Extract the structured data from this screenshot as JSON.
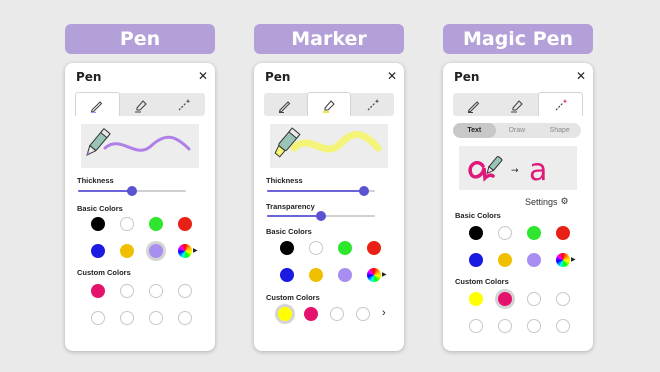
{
  "banners": [
    "Pen",
    "Marker",
    "Magic Pen"
  ],
  "panel_title": "Pen",
  "close_glyph": "✕",
  "section_basic": "Basic Colors",
  "section_custom": "Custom Colors",
  "pen": {
    "thickness_label": "Thickness",
    "thickness_value": 0.5,
    "basic_colors": [
      "#000000",
      "#ffffff",
      "#2ee62e",
      "#e82015",
      "#1a1ae0",
      "#f0c000",
      "#a88ef0",
      "wheel"
    ],
    "selected_basic": 6,
    "custom_colors": [
      "#e5126d",
      "empty",
      "empty",
      "empty",
      "empty",
      "empty",
      "empty",
      "empty"
    ]
  },
  "marker": {
    "thickness_label": "Thickness",
    "thickness_value": 0.9,
    "transparency_label": "Transparency",
    "transparency_value": 0.5,
    "basic_colors": [
      "#000000",
      "#ffffff",
      "#2ee62e",
      "#e82015",
      "#1a1ae0",
      "#f0c000",
      "#a88ef0",
      "wheel"
    ],
    "custom_colors": [
      "#ffff00",
      "#e5126d",
      "empty",
      "empty"
    ],
    "selected_custom": 0
  },
  "magic": {
    "modes": [
      "Text",
      "Draw",
      "Shape"
    ],
    "active_mode": 0,
    "demo_result": "a",
    "demo_arrow": "→",
    "settings_label": "Settings",
    "basic_colors": [
      "#000000",
      "#ffffff",
      "#2ee62e",
      "#e82015",
      "#1a1ae0",
      "#f0c000",
      "#a88ef0",
      "wheel"
    ],
    "custom_colors": [
      "#ffff00",
      "#e5126d",
      "empty",
      "empty",
      "empty",
      "empty",
      "empty",
      "empty"
    ],
    "selected_custom": 1
  },
  "colors": {
    "banner": "#b4a0d8",
    "accent": "#5a52d0",
    "pen_stroke": "#b080e8",
    "marker_stroke": "#f4f478",
    "magic_pink": "#e0187a"
  }
}
